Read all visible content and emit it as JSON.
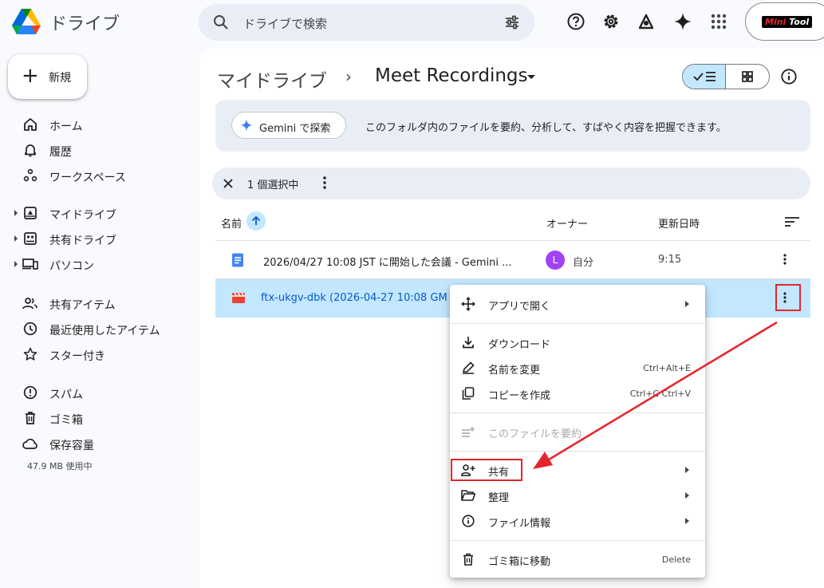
{
  "app": {
    "title": "ドライブ"
  },
  "search": {
    "placeholder": "ドライブで検索"
  },
  "header_icons": [
    "help-icon",
    "settings-icon",
    "mode-icon",
    "gemini-icon",
    "apps-icon"
  ],
  "brand_badge": {
    "part1": "Mini",
    "part2": "Tool"
  },
  "sidebar": {
    "new_label": "新規",
    "items": [
      {
        "label": "ホーム",
        "icon": "home-icon"
      },
      {
        "label": "履歴",
        "icon": "bell-icon"
      },
      {
        "label": "ワークスペース",
        "icon": "workspace-icon"
      },
      {
        "label": "マイドライブ",
        "icon": "my-drive-icon"
      },
      {
        "label": "共有ドライブ",
        "icon": "shared-drive-icon"
      },
      {
        "label": "パソコン",
        "icon": "computer-icon"
      },
      {
        "label": "共有アイテム",
        "icon": "people-icon"
      },
      {
        "label": "最近使用したアイテム",
        "icon": "clock-icon"
      },
      {
        "label": "スター付き",
        "icon": "star-icon"
      },
      {
        "label": "スパム",
        "icon": "spam-icon"
      },
      {
        "label": "ゴミ箱",
        "icon": "trash-icon"
      },
      {
        "label": "保存容量",
        "icon": "cloud-icon"
      }
    ],
    "storage_usage": "47.9 MB 使用中"
  },
  "breadcrumb": {
    "root": "マイドライブ",
    "separator": "›",
    "folder": "Meet Recordings"
  },
  "gemini": {
    "chip_label": "Gemini で探索",
    "description": "このフォルダ内のファイルを要約、分析して、すばやく内容を把握できます。"
  },
  "selection": {
    "text": "1 個選択中"
  },
  "columns": {
    "name": "名前",
    "owner": "オーナー",
    "modified": "更新日時"
  },
  "files": [
    {
      "name": "2026/04/27 10:08 JST に開始した会議 - Gemini ...",
      "owner_initial": "L",
      "owner": "自分",
      "modified": "9:15",
      "icon": "doc-icon"
    },
    {
      "name": "ftx-ukgv-dbk (2026-04-27 10:08 GM",
      "icon": "video-icon"
    }
  ],
  "menu": {
    "open_with": "アプリで開く",
    "download": "ダウンロード",
    "rename": "名前を変更",
    "rename_shortcut": "Ctrl+Alt+E",
    "copy": "コピーを作成",
    "copy_shortcut": "Ctrl+C Ctrl+V",
    "summarize": "このファイルを要約",
    "share": "共有",
    "organize": "整理",
    "file_info": "ファイル情報",
    "trash": "ゴミ箱に移動",
    "trash_shortcut": "Delete"
  },
  "colors": {
    "accent": "#0b57d0",
    "selected_row": "#c2e7ff",
    "annotation_red": "#e3262d"
  }
}
